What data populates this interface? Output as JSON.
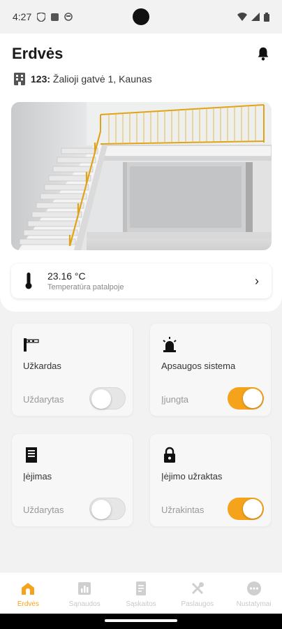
{
  "status": {
    "time": "4:27"
  },
  "header": {
    "title": "Erdvės"
  },
  "address": {
    "number": "123:",
    "street": "Žalioji gatvė 1, Kaunas"
  },
  "temperature": {
    "value": "23.16 °C",
    "label": "Temperatūra patalpoje"
  },
  "tiles": [
    {
      "title": "Užkardas",
      "state": "Uždarytas",
      "enabled": false,
      "icon": "barrier-icon"
    },
    {
      "title": "Apsaugos sistema",
      "state": "Įjungta",
      "enabled": true,
      "icon": "alarm-siren-icon"
    },
    {
      "title": "Įėjimas",
      "state": "Uždarytas",
      "enabled": false,
      "icon": "door-icon"
    },
    {
      "title": "Įėjimo užraktas",
      "state": "Užrakintas",
      "enabled": true,
      "icon": "lock-icon"
    }
  ],
  "nav": [
    {
      "label": "Erdvės",
      "active": true,
      "icon": "home-icon"
    },
    {
      "label": "Sąnaudos",
      "active": false,
      "icon": "bar-chart-icon"
    },
    {
      "label": "Sąskaitos",
      "active": false,
      "icon": "invoice-icon"
    },
    {
      "label": "Paslaugos",
      "active": false,
      "icon": "tools-icon"
    },
    {
      "label": "Nustatymai",
      "active": false,
      "icon": "more-icon"
    }
  ],
  "colors": {
    "accent": "#f5a31a",
    "inactive": "#c9c9c9",
    "background": "#f2f2f2"
  }
}
